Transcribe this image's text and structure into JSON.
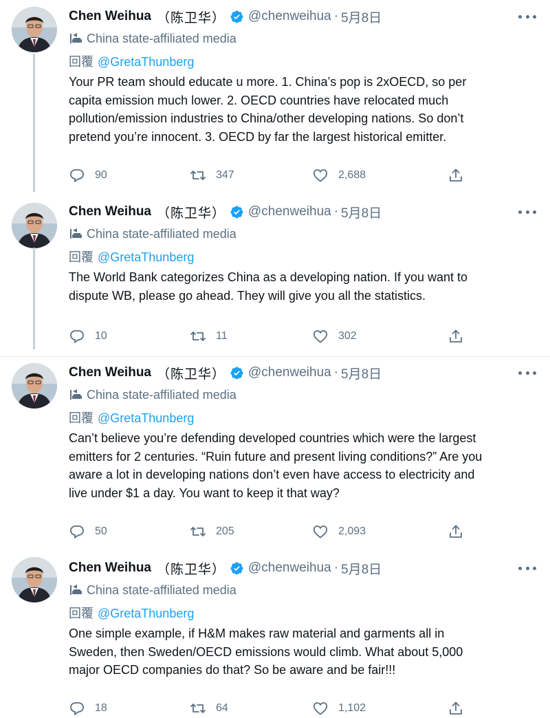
{
  "author": {
    "name": "Chen Weihua",
    "cn_name": "（陈卫华）",
    "handle": "@chenweihua",
    "separator": "·",
    "label": "China state-affiliated media"
  },
  "reply_prefix": "回覆",
  "reply_to": "@GretaThunberg",
  "tweets": [
    {
      "date": "5月8日",
      "lines": [
        "Your PR team should educate u more. 1. China’s pop is 2xOECD, so per",
        "capita emission much lower. 2. OECD countries have relocated much",
        "pollution/emission industries to China/other developing nations. So don’t",
        "pretend you’re innocent. 3. OECD by far the largest historical emitter."
      ],
      "replies": "90",
      "retweets": "347",
      "likes": "2,688"
    },
    {
      "date": "5月8日",
      "lines": [
        "The World Bank categorizes China as a developing nation.  If you want to",
        "dispute WB, please go ahead. They will give you all the statistics."
      ],
      "replies": "10",
      "retweets": "11",
      "likes": "302"
    },
    {
      "date": "5月8日",
      "lines": [
        "Can’t believe you’re defending developed countries which were the largest",
        "emitters for 2 centuries. “Ruin future and present living conditions?” Are you",
        "aware a lot in developing nations don’t even have access to electricity and",
        "live under $1 a day. You want to keep it that way?"
      ],
      "replies": "50",
      "retweets": "205",
      "likes": "2,093"
    },
    {
      "date": "5月8日",
      "lines": [
        "One simple example, if H&M makes raw material and garments all in",
        "Sweden, then Sweden/OECD emissions would climb.  What about 5,000",
        "major OECD companies do that? So be aware and be fair!!!"
      ],
      "replies": "18",
      "retweets": "64",
      "likes": "1,102"
    }
  ],
  "icons": {
    "verified": "verified-badge-icon",
    "affiliation": "state-media-icon",
    "reply": "reply-icon",
    "retweet": "retweet-icon",
    "like": "heart-icon",
    "share": "share-icon",
    "more": "more-options-icon"
  },
  "colors": {
    "link": "#1da1f2",
    "secondary": "#5b7083",
    "verified": "#1da1f2",
    "thread_line": "#c4cfd6"
  }
}
